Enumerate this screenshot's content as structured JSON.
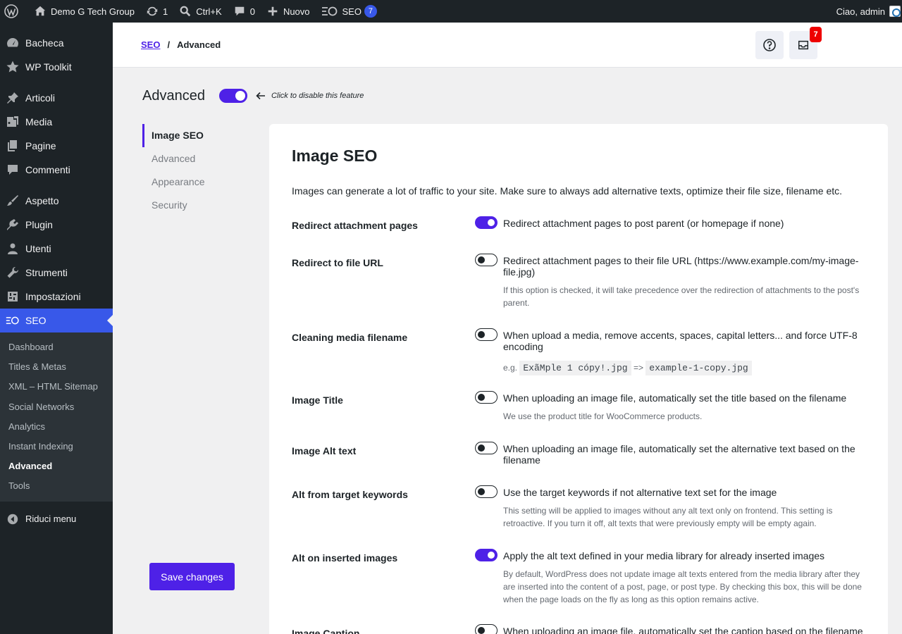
{
  "adminbar": {
    "site_name": "Demo G Tech Group",
    "updates_count": "1",
    "search_shortcut": "Ctrl+K",
    "comments_count": "0",
    "new_label": "Nuovo",
    "seo_label": "SEO",
    "seo_count": "7",
    "greeting": "Ciao, admin"
  },
  "sidebar": {
    "items": [
      {
        "label": "Bacheca",
        "icon": "dashboard-icon"
      },
      {
        "label": "WP Toolkit",
        "icon": "star-icon"
      },
      {
        "label": "Articoli",
        "icon": "pin-icon"
      },
      {
        "label": "Media",
        "icon": "media-icon"
      },
      {
        "label": "Pagine",
        "icon": "pages-icon"
      },
      {
        "label": "Commenti",
        "icon": "comment-icon"
      },
      {
        "label": "Aspetto",
        "icon": "brush-icon"
      },
      {
        "label": "Plugin",
        "icon": "plugin-icon"
      },
      {
        "label": "Utenti",
        "icon": "user-icon"
      },
      {
        "label": "Strumenti",
        "icon": "wrench-icon"
      },
      {
        "label": "Impostazioni",
        "icon": "settings-icon"
      },
      {
        "label": "SEO",
        "icon": "seo-icon"
      }
    ],
    "submenu": [
      "Dashboard",
      "Titles & Metas",
      "XML – HTML Sitemap",
      "Social Networks",
      "Analytics",
      "Instant Indexing",
      "Advanced",
      "Tools"
    ],
    "collapse_label": "Riduci menu"
  },
  "topbar": {
    "breadcrumb_root": "SEO",
    "breadcrumb_sep": "/",
    "breadcrumb_current": "Advanced",
    "notifications_count": "7"
  },
  "page": {
    "title": "Advanced",
    "toggle_hint": "Click to disable this feature",
    "save_label": "Save changes"
  },
  "tabs": [
    "Image SEO",
    "Advanced",
    "Appearance",
    "Security"
  ],
  "card": {
    "title": "Image SEO",
    "description": "Images can generate a lot of traffic to your site. Make sure to always add alternative texts, optimize their file size, filename etc.",
    "options": [
      {
        "label": "Redirect attachment pages",
        "on": true,
        "text": "Redirect attachment pages to post parent (or homepage if none)",
        "help": ""
      },
      {
        "label": "Redirect to file URL",
        "on": false,
        "text": "Redirect attachment pages to their file URL (https://www.example.com/my-image-file.jpg)",
        "help": "If this option is checked, it will take precedence over the redirection of attachments to the post's parent."
      },
      {
        "label": "Cleaning media filename",
        "on": false,
        "text": "When upload a media, remove accents, spaces, capital letters... and force UTF-8 encoding",
        "help_prefix": "e.g.",
        "code_from": "ExãMple 1 cópy!.jpg",
        "arrow": "=>",
        "code_to": "example-1-copy.jpg"
      },
      {
        "label": "Image Title",
        "on": false,
        "text": "When uploading an image file, automatically set the title based on the filename",
        "help": "We use the product title for WooCommerce products."
      },
      {
        "label": "Image Alt text",
        "on": false,
        "text": "When uploading an image file, automatically set the alternative text based on the filename",
        "help": ""
      },
      {
        "label": "Alt from target keywords",
        "on": false,
        "text": "Use the target keywords if not alternative text set for the image",
        "help": "This setting will be applied to images without any alt text only on frontend. This setting is retroactive. If you turn it off, alt texts that were previously empty will be empty again."
      },
      {
        "label": "Alt on inserted images",
        "on": true,
        "text": "Apply the alt text defined in your media library for already inserted images",
        "help": "By default, WordPress does not update image alt texts entered from the media library after they are inserted into the content of a post, page, or post type. By checking this box, this will be done when the page loads on the fly as long as this option remains active."
      },
      {
        "label": "Image Caption",
        "on": false,
        "text": "When uploading an image file, automatically set the caption based on the filename",
        "help": ""
      }
    ]
  }
}
